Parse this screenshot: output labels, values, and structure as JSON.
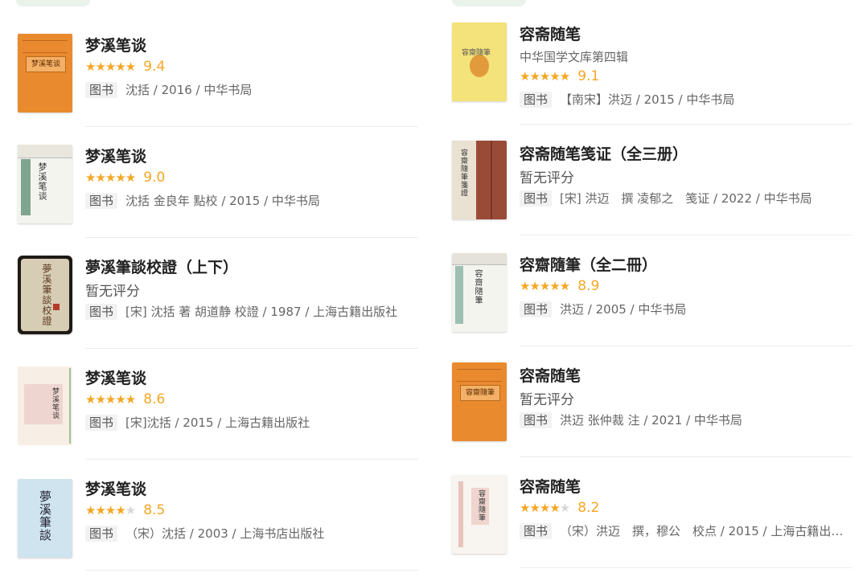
{
  "left_column": [
    {
      "title": "梦溪笔谈",
      "stars": "★★★★★",
      "score": "9.4",
      "tag": "图书",
      "meta": "沈括 / 2016 / 中华书局",
      "cover_text": "梦溪笔谈"
    },
    {
      "title": "梦溪笔谈",
      "stars": "★★★★★",
      "score": "9.0",
      "tag": "图书",
      "meta": "沈括 金良年 點校 / 2015 / 中华书局",
      "cover_text": "梦溪笔谈"
    },
    {
      "title": "夢溪筆談校證（上下）",
      "no_rating": "暂无评分",
      "tag": "图书",
      "meta": "[宋] 沈括 著 胡道静 校證 / 1987 / 上海古籍出版社",
      "cover_text": "夢溪筆談校證"
    },
    {
      "title": "梦溪笔谈",
      "stars": "★★★★★",
      "score": "8.6",
      "tag": "图书",
      "meta": "[宋]沈括 / 2015 / 上海古籍出版社",
      "cover_text": "梦溪笔谈"
    },
    {
      "title": "梦溪笔谈",
      "stars": "★★★★",
      "stars_off": "★",
      "score": "8.5",
      "tag": "图书",
      "meta": "（宋）沈括 / 2003 / 上海书店出版社",
      "cover_text": "夢溪筆談"
    }
  ],
  "right_column": [
    {
      "title": "容斋随笔",
      "subtitle": "中华国学文库第四辑",
      "stars": "★★★★★",
      "score": "9.1",
      "tag": "图书",
      "meta": "【南宋】洪迈 / 2015 / 中华书局",
      "cover_text": "容齋隨筆"
    },
    {
      "title": "容斋随笔笺证（全三册）",
      "no_rating": "暂无评分",
      "tag": "图书",
      "meta": "[宋] 洪迈　撰 凌郁之　笺证 / 2022 / 中华书局",
      "cover_text": "容齋隨筆箋證"
    },
    {
      "title": "容齋隨筆（全二冊）",
      "stars": "★★★★★",
      "score": "8.9",
      "tag": "图书",
      "meta": "洪迈 / 2005 / 中华书局",
      "cover_text": "容齋隨筆"
    },
    {
      "title": "容斋随笔",
      "no_rating": "暂无评分",
      "tag": "图书",
      "meta": "洪迈 张仲裁 注 / 2021 / 中华书局",
      "cover_text": "容齋隨筆"
    },
    {
      "title": "容斋随笔",
      "stars": "★★★★",
      "stars_off": "★",
      "score": "8.2",
      "tag": "图书",
      "meta": "（宋）洪迈　撰，穆公　校点 / 2015 / 上海古籍出…",
      "cover_text": "容齋隨筆"
    }
  ],
  "colors": {
    "star": "#f5a623",
    "cover_orange": "#e98a2e",
    "cover_yellow": "#f4e27a",
    "cover_brown": "#9a4b38",
    "cover_blue": "#cfe4ef",
    "cover_cream": "#f7efe6"
  }
}
